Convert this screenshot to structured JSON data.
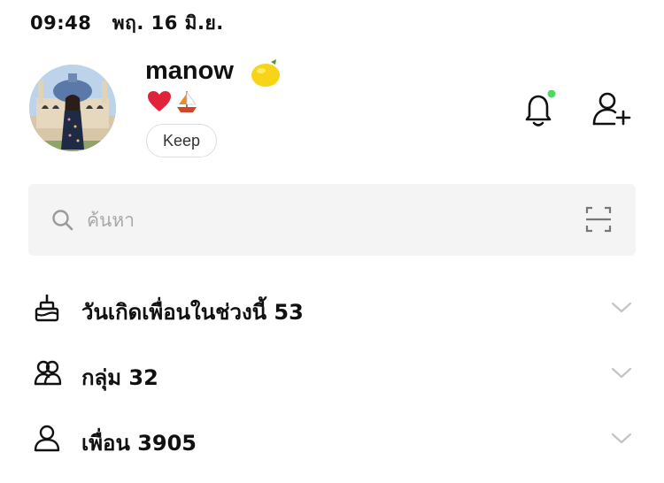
{
  "status_bar": {
    "time": "09:48",
    "date": "พฤ. 16 มิ.ย."
  },
  "profile": {
    "name": "manow",
    "name_emoji": "lemon-icon",
    "status_icons": [
      "heart-icon",
      "sailboat-icon"
    ],
    "keep_label": "Keep",
    "avatar": "profile-photo"
  },
  "header_actions": {
    "notification_dot_color": "#4cd964",
    "icons": [
      "bell-icon",
      "add-friend-icon"
    ]
  },
  "search": {
    "placeholder": "ค้นหา",
    "value": "",
    "icons": [
      "search-icon",
      "scan-icon"
    ]
  },
  "sections": [
    {
      "label": "วันเกิดเพื่อนในช่วงนี้",
      "count": "53",
      "icon": "cake-icon"
    },
    {
      "label": "กลุ่ม",
      "count": "32",
      "icon": "group-icon"
    },
    {
      "label": "เพื่อน",
      "count": "3905",
      "icon": "friend-icon"
    }
  ]
}
